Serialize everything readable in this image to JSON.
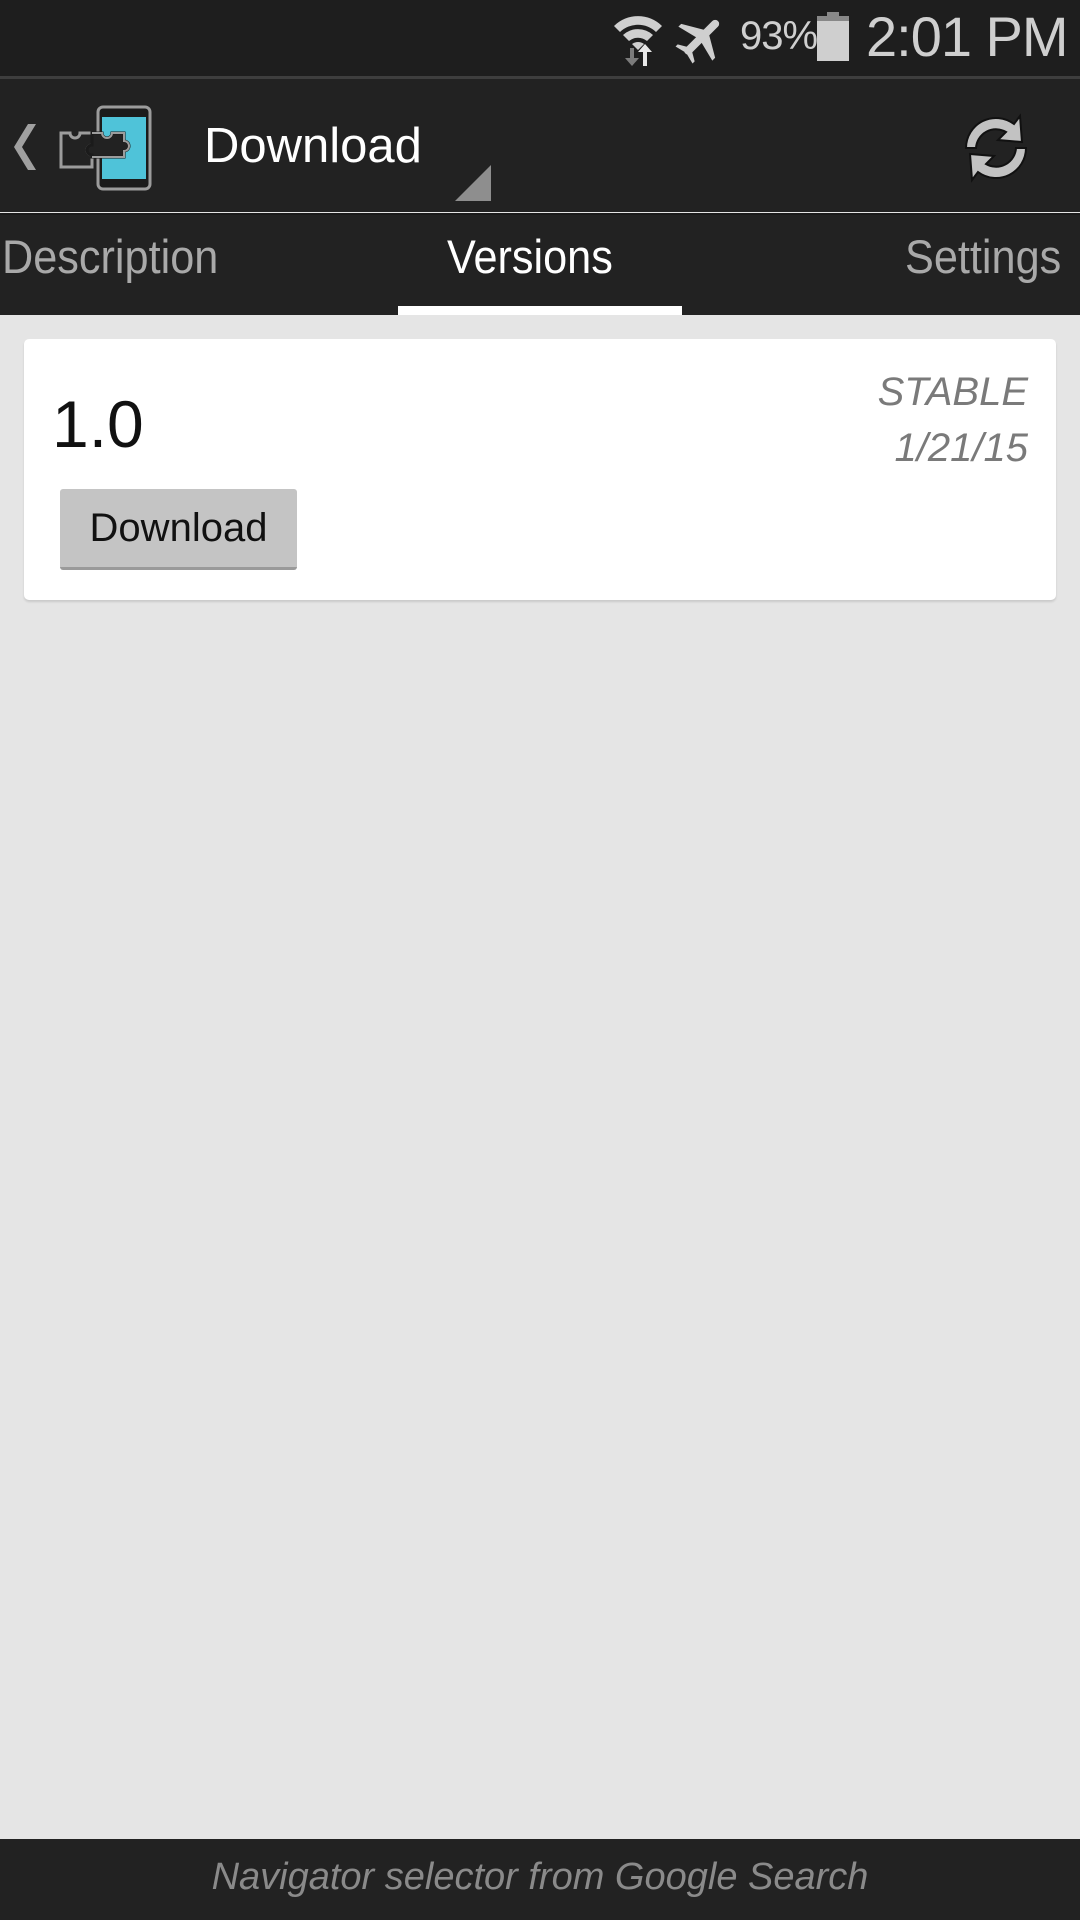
{
  "status_bar": {
    "icons": [
      "wifi-data-icon",
      "airplane-mode-icon",
      "battery-icon"
    ],
    "battery_percent": "93%",
    "time": "2:01 PM"
  },
  "action_bar": {
    "back_icon": "chevron-left-icon",
    "app_icon": "xposed-puzzle-phone-icon",
    "title": "Download",
    "spinner_icon": "dropdown-triangle-icon",
    "refresh_icon": "refresh-icon"
  },
  "tabs": [
    {
      "label": "Description",
      "active": false
    },
    {
      "label": "Versions",
      "active": true
    },
    {
      "label": "Settings",
      "active": false
    }
  ],
  "versions": [
    {
      "version": "1.0",
      "channel": "STABLE",
      "date": "1/21/15",
      "button_label": "Download"
    }
  ],
  "footer": {
    "text": "Navigator selector from Google Search"
  },
  "colors": {
    "bar_background": "#222222",
    "content_background": "#e5e5e5",
    "accent_cyan": "#4fc3d9",
    "tab_inactive": "#a9a9a9",
    "tab_active": "#ffffff"
  }
}
